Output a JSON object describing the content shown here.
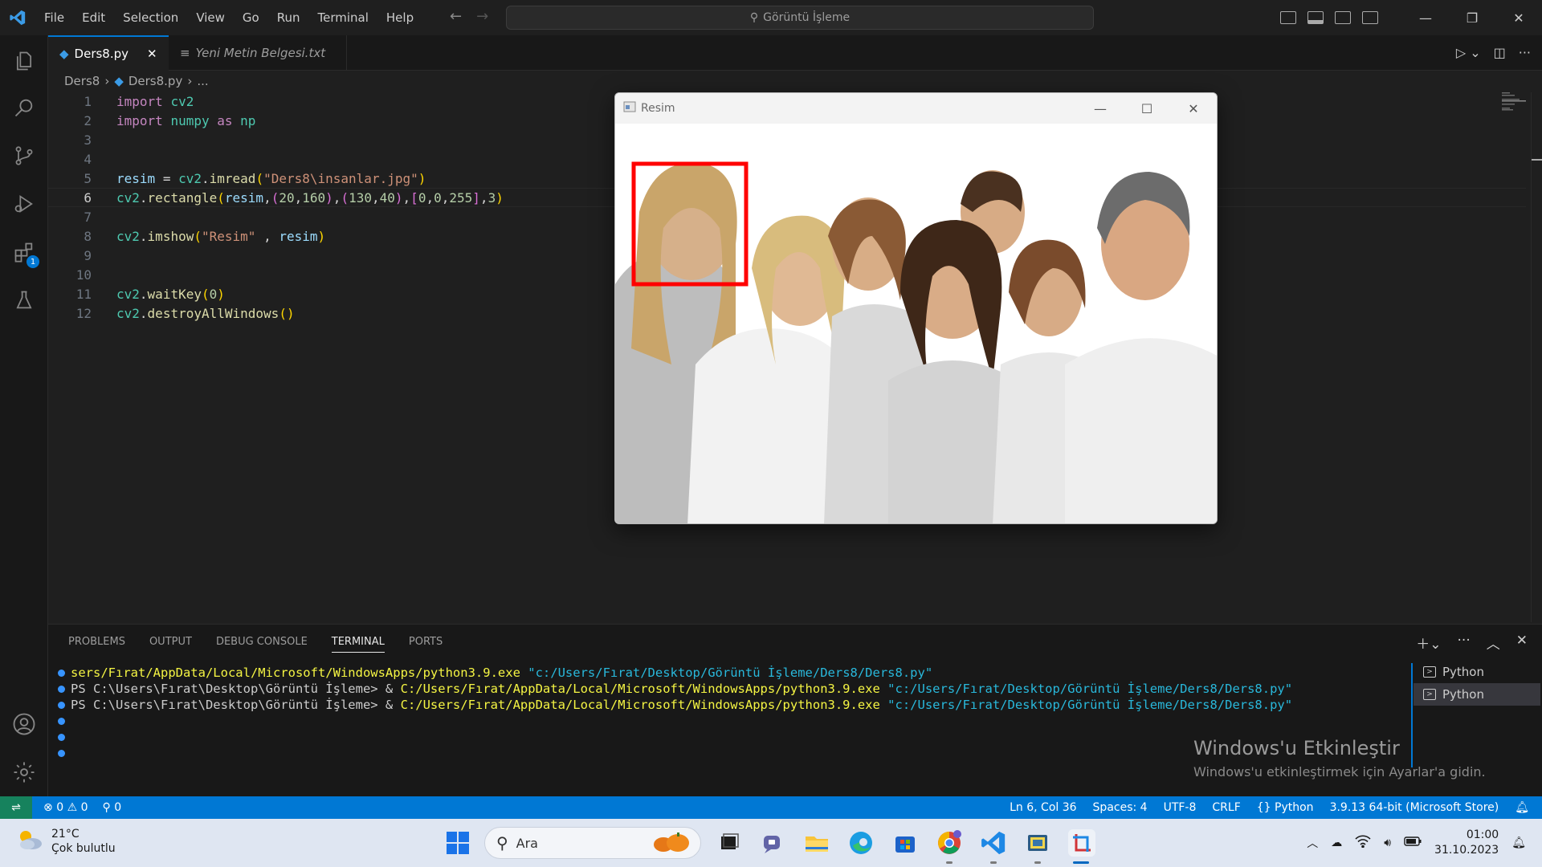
{
  "titlebar": {
    "menu": [
      "File",
      "Edit",
      "Selection",
      "View",
      "Go",
      "Run",
      "Terminal",
      "Help"
    ],
    "search_text": "Görüntü İşleme"
  },
  "tabs": [
    {
      "label": "Ders8.py",
      "active": true
    },
    {
      "label": "Yeni Metin Belgesi.txt",
      "active": false
    }
  ],
  "breadcrumb": {
    "folder": "Ders8",
    "file": "Ders8.py",
    "more": "..."
  },
  "activity_badge": "1",
  "editor": {
    "current_line": 6,
    "line_numbers": [
      "1",
      "2",
      "3",
      "4",
      "5",
      "6",
      "7",
      "8",
      "9",
      "10",
      "11",
      "12"
    ],
    "lines": [
      "import cv2",
      "import numpy as np",
      "",
      "",
      "resim = cv2.imread(\"Ders8\\insanlar.jpg\")",
      "cv2.rectangle(resim,(20,160),(130,40),[0,0,255],3)",
      "",
      "cv2.imshow(\"Resim\" , resim)",
      "",
      "",
      "cv2.waitKey(0)",
      "cv2.destroyAllWindows()"
    ]
  },
  "panel": {
    "tabs": [
      "PROBLEMS",
      "OUTPUT",
      "DEBUG CONSOLE",
      "TERMINAL",
      "PORTS"
    ],
    "active_tab": "TERMINAL",
    "terminal_lines": [
      {
        "prompt": "",
        "cmd": "sers/Fırat/AppData/Local/Microsoft/WindowsApps/python3.9.exe",
        "arg": " \"c:/Users/Fırat/Desktop/Görüntü İşleme/Ders8/Ders8.py\""
      },
      {
        "prompt": "PS C:\\Users\\Fırat\\Desktop\\Görüntü İşleme> & ",
        "cmd": "C:/Users/Fırat/AppData/Local/Microsoft/WindowsApps/python3.9.exe",
        "arg": " \"c:/Users/Fırat/Desktop/Görüntü İşleme/Ders8/Ders8.py\""
      },
      {
        "prompt": "PS C:\\Users\\Fırat\\Desktop\\Görüntü İşleme> & ",
        "cmd": "C:/Users/Fırat/AppData/Local/Microsoft/WindowsApps/python3.9.exe",
        "arg": " \"c:/Users/Fırat/Desktop/Görüntü İşleme/Ders8/Ders8.py\""
      }
    ],
    "terminals": [
      "Python",
      "Python"
    ]
  },
  "watermark": {
    "title": "Windows'u Etkinleştir",
    "subtitle": "Windows'u etkinleştirmek için Ayarlar'a gidin."
  },
  "statusbar": {
    "errors": "0",
    "warnings": "0",
    "ports": "0",
    "position": "Ln 6, Col 36",
    "spaces": "Spaces: 4",
    "encoding": "UTF-8",
    "eol": "CRLF",
    "language": "Python",
    "interpreter": "3.9.13 64-bit (Microsoft Store)"
  },
  "resim_window": {
    "title": "Resim"
  },
  "taskbar": {
    "temperature": "21°C",
    "weather": "Çok bulutlu",
    "search_placeholder": "Ara",
    "time": "01:00",
    "date": "31.10.2023"
  },
  "colors": {
    "accent": "#0078d4",
    "remote": "#16825d",
    "rect": "#ff0000"
  }
}
